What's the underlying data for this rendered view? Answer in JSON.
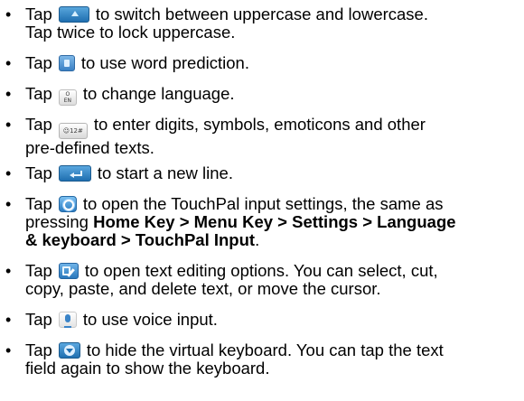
{
  "bullet_char": "•",
  "items": [
    {
      "pre": "Tap",
      "icon": "shift-key-icon",
      "line1": "to switch between uppercase and lowercase.",
      "line2": "Tap twice to lock uppercase."
    },
    {
      "pre": "Tap",
      "icon": "word-prediction-key-icon",
      "line1": "to use word prediction."
    },
    {
      "pre": "Tap",
      "icon": "language-key-icon",
      "icon_label_top": "O",
      "icon_label_bottom": "EN",
      "line1": "to change language."
    },
    {
      "pre": "Tap",
      "icon": "symbols-key-icon",
      "icon_label": "☺12#",
      "line1": "to enter digits, symbols, emoticons and other",
      "line2": "pre-defined texts."
    },
    {
      "pre": "Tap",
      "icon": "enter-key-icon",
      "line1": "to start a new line."
    },
    {
      "pre": "Tap",
      "icon": "settings-key-icon",
      "line1": "to open the TouchPal input settings, the same as",
      "line2_plain": "pressing ",
      "line2_bold": "Home Key > Menu Key > Settings > Language",
      "line3_bold": "& keyboard > TouchPal Input",
      "line3_end": "."
    },
    {
      "pre": "Tap",
      "icon": "text-edit-key-icon",
      "line1": "to open text editing options. You can select, cut,",
      "line2": "copy, paste, and delete text, or move the cursor."
    },
    {
      "pre": "Tap",
      "icon": "voice-input-key-icon",
      "line1": "to use voice input."
    },
    {
      "pre": "Tap",
      "icon": "hide-keyboard-key-icon",
      "line1": "to hide the virtual keyboard. You can tap the text",
      "line2": "field again to show the keyboard."
    }
  ]
}
